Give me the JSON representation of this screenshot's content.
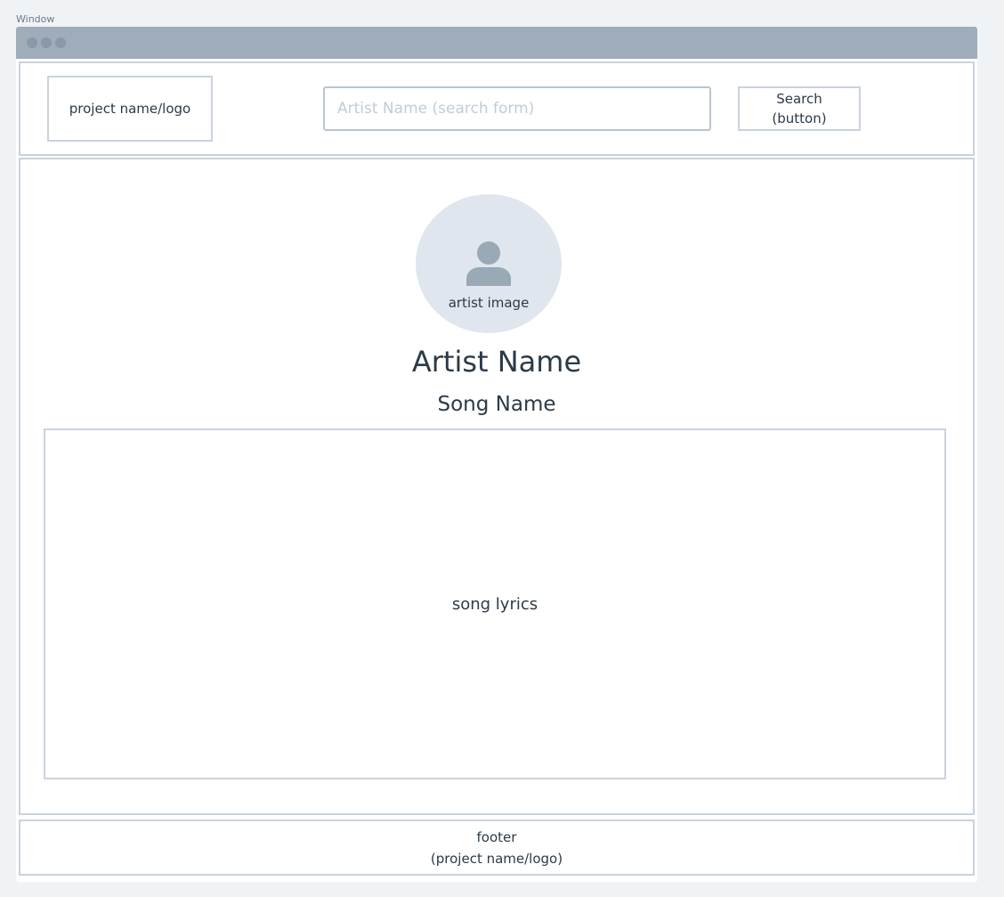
{
  "canvas": {
    "label": "Window"
  },
  "header": {
    "logo_text": "project name/logo",
    "search_placeholder": "Artist Name (search form)",
    "search_value": "",
    "search_button_label": "Search\n(button)"
  },
  "main": {
    "artist_image_label": "artist image",
    "artist_image_icon": "user-silhouette-icon",
    "artist_name": "Artist Name",
    "song_name": "Song Name",
    "lyrics_placeholder": "song lyrics"
  },
  "footer": {
    "text": "footer\n(project name/logo)"
  },
  "colors": {
    "titlebar": "#9eadb9",
    "border": "#c9d3dc",
    "avatar_bg": "#e0e6ed",
    "icon": "#9aa9b6",
    "text": "#2b3a48",
    "placeholder": "#c1ccd6"
  }
}
